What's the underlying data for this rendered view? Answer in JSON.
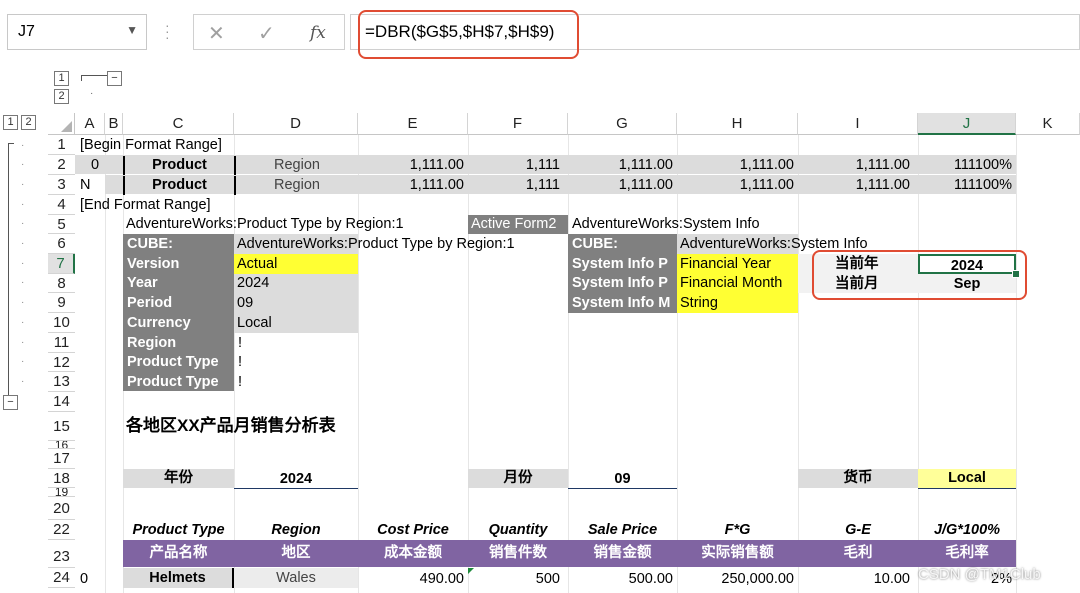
{
  "name_box": "J7",
  "formula": "=DBR($G$5,$H$7,$H$9)",
  "icons": {
    "cancel": "cancel-icon",
    "enter": "check-icon",
    "fx": "fx-icon",
    "dropdown": "chevron-down-icon"
  },
  "fx_label": "fx",
  "outline": {
    "level1": "1",
    "level2": "2",
    "collapse": "−"
  },
  "columns": [
    "A",
    "B",
    "C",
    "D",
    "E",
    "F",
    "G",
    "H",
    "I",
    "J",
    "K"
  ],
  "rows": [
    "1",
    "2",
    "3",
    "4",
    "5",
    "6",
    "7",
    "8",
    "9",
    "10",
    "11",
    "12",
    "13",
    "14",
    "15",
    "16",
    "17",
    "18",
    "19",
    "20",
    "22",
    "23",
    "24"
  ],
  "r1": {
    "a": "[Begin Format Range]"
  },
  "r2": {
    "a": "0",
    "c": "Product",
    "d": "Region",
    "e": "1,111.00",
    "f": "1,111",
    "g": "1,111.00",
    "h": "1,111.00",
    "i": "1,111.00",
    "j": "111100%"
  },
  "r3": {
    "a": "N",
    "c": "Product",
    "d": "Region",
    "e": "1,111.00",
    "f": "1,111",
    "g": "1,111.00",
    "h": "1,111.00",
    "i": "1,111.00",
    "j": "111100%"
  },
  "r4": {
    "a": "[End Format Range]"
  },
  "r5": {
    "c": "AdventureWorks:Product Type by Region:1",
    "g": "Active Form2",
    "h": "AdventureWorks:System Info"
  },
  "r6": {
    "c": "CUBE:",
    "d": "AdventureWorks:Product Type by Region:1",
    "g": "CUBE:",
    "h": "AdventureWorks:System Info"
  },
  "r7": {
    "c": "Version",
    "d": "Actual",
    "g": "System Info P",
    "h": "Financial Year",
    "i": "当前年",
    "j": "2024"
  },
  "r8": {
    "c": "Year",
    "d": "2024",
    "g": "System Info P",
    "h": "Financial Month",
    "i": "当前月",
    "j": "Sep"
  },
  "r9": {
    "c": "Period",
    "d": "09",
    "g": "System Info M",
    "h": "String"
  },
  "r10": {
    "c": "Currency",
    "d": "Local"
  },
  "r11": {
    "c": "Region",
    "d": "!"
  },
  "r12": {
    "c": "Product Type",
    "d": "!"
  },
  "r13": {
    "c": "Product Type",
    "d": "!"
  },
  "r15": {
    "c": "各地区XX产品月销售分析表"
  },
  "r18": {
    "c": "年份",
    "d": "2024",
    "f": "月份",
    "g": "09",
    "i": "货币",
    "j": "Local"
  },
  "r22": {
    "c": "Product Type",
    "d": "Region",
    "e": "Cost Price",
    "f": "Quantity",
    "g": "Sale Price",
    "h": "F*G",
    "i": "G-E",
    "j": "J/G*100%"
  },
  "r23": {
    "c": "产品名称",
    "d": "地区",
    "e": "成本金额",
    "f": "销售件数",
    "g": "销售金额",
    "h": "实际销售额",
    "i": "毛利",
    "j": "毛利率"
  },
  "r24": {
    "a": "0",
    "c": "Helmets",
    "d": "Wales",
    "e": "490.00",
    "f": "500",
    "g": "500.00",
    "h": "250,000.00",
    "i": "10.00",
    "j": "2%"
  },
  "watermark": "CSDN @TM1Club",
  "colors": {
    "accent": "#217346",
    "highlight": "#e04c33",
    "purple": "#8064a2",
    "yellow": "#ffff33"
  }
}
